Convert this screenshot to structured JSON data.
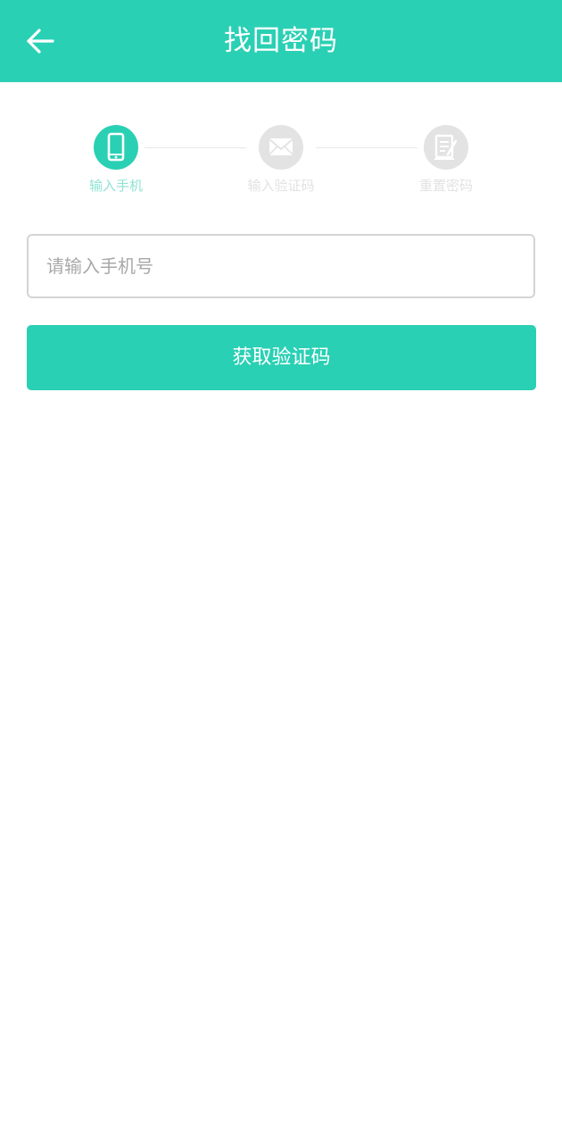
{
  "header": {
    "title": "找回密码",
    "back_icon": "arrow-left-icon"
  },
  "stepper": {
    "steps": [
      {
        "label": "输入手机",
        "icon": "phone-icon",
        "state": "active"
      },
      {
        "label": "输入验证码",
        "icon": "envelope-icon",
        "state": "inactive"
      },
      {
        "label": "重置密码",
        "icon": "edit-document-icon",
        "state": "inactive"
      }
    ]
  },
  "form": {
    "phone_placeholder": "请输入手机号",
    "phone_value": ""
  },
  "actions": {
    "submit_label": "获取验证码"
  },
  "colors": {
    "primary": "#2ad0b4",
    "inactive_step": "#e3e3e3",
    "input_border": "#d4d4d4",
    "placeholder": "#a8a8a8"
  }
}
